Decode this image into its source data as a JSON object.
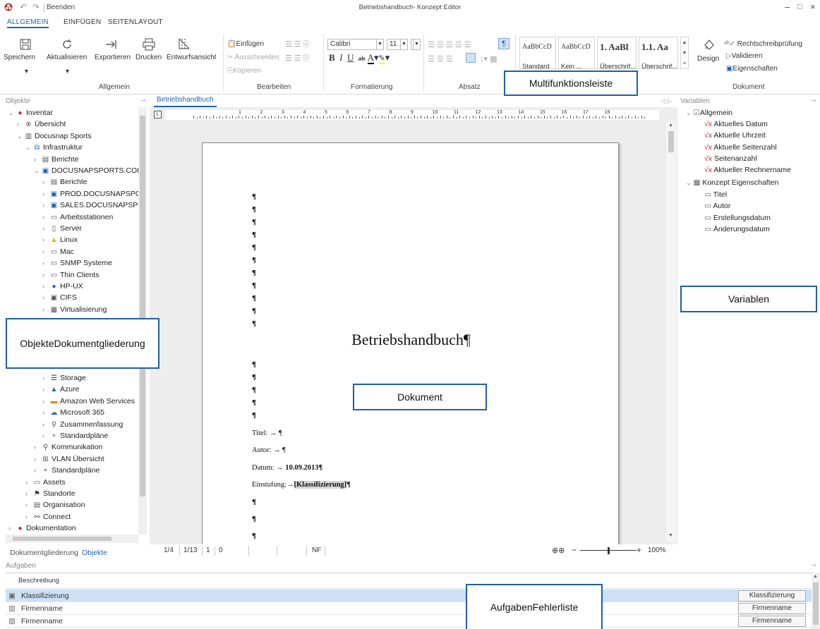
{
  "titlebar": {
    "quit_label": "Beenden",
    "title": "Betriebshandbuch- Konzept Editor",
    "minimize": "–",
    "maximize": "□",
    "close": "×"
  },
  "ribbon_tabs": [
    "ALLGEMEIN",
    "EINFÜGEN",
    "SEITENLAYOUT"
  ],
  "ribbon": {
    "allgemein": {
      "buttons": [
        "Speichern",
        "Aktualisieren",
        "Exportieren",
        "Drucken",
        "Entwurfsansicht"
      ],
      "label": "Allgemein"
    },
    "bearbeiten": {
      "einfuegen": "Einfügen",
      "ausschneiden": "Ausschneiden",
      "kopieren": "Kopieren",
      "label": "Bearbeiten"
    },
    "formatierung": {
      "font": "Calibri",
      "size": "11",
      "label": "Formatierung"
    },
    "absatz": {
      "label": "Absatz"
    },
    "styles": [
      {
        "sample": "AaBbCcD",
        "name": "Standard"
      },
      {
        "sample": "AaBbCcD",
        "name": "Kein ..."
      },
      {
        "sample": "1. AaBl",
        "name": "Überschrif..."
      },
      {
        "sample": "1.1. Aa",
        "name": "Überschrif..."
      }
    ],
    "dokument": {
      "design": "Design",
      "rechtschreibung": "Rechtschreibprüfung",
      "validieren": "Validieren",
      "eigenschaften": "Eigenschaften",
      "label": "Dokument"
    }
  },
  "callouts": {
    "ribbon": "Multifunktionsleiste",
    "objekte_l1": "Objekte",
    "objekte_l2": "Dokumentgliederung",
    "dokument": "Dokument",
    "variablen": "Variablen",
    "aufgaben_l1": "Aufgaben",
    "aufgaben_l2": "Fehlerliste"
  },
  "left_panel": {
    "header": "Objekte",
    "tree": [
      {
        "label": "Inventar",
        "chev": "⌄",
        "icon": "inventory-icon"
      },
      {
        "label": "Übersicht",
        "chev": "›",
        "icon": "globe-icon"
      },
      {
        "label": "Docusnap Sports",
        "chev": "⌄",
        "icon": "company-icon"
      },
      {
        "label": "Infrastruktur",
        "chev": "⌄",
        "icon": "network-icon"
      },
      {
        "label": "Berichte",
        "chev": "›",
        "icon": "report-icon"
      },
      {
        "label": "DOCUSNAPSPORTS.COM",
        "chev": "⌄",
        "icon": "domain-icon"
      },
      {
        "label": "Berichte",
        "chev": "›",
        "icon": "report-icon"
      },
      {
        "label": "PROD.DOCUSNAPSPORTS",
        "chev": "›",
        "icon": "domain-icon"
      },
      {
        "label": "SALES.DOCUSNAPSPORTS",
        "chev": "›",
        "icon": "domain-icon"
      },
      {
        "label": "Arbeitsstationen",
        "chev": "›",
        "icon": "workstation-icon"
      },
      {
        "label": "Server",
        "chev": "›",
        "icon": "server-icon"
      },
      {
        "label": "Linux",
        "chev": "›",
        "icon": "linux-icon"
      },
      {
        "label": "Mac",
        "chev": "›",
        "icon": "mac-icon"
      },
      {
        "label": "SNMP Systeme",
        "chev": "›",
        "icon": "snmp-icon"
      },
      {
        "label": "Thin Clients",
        "chev": "›",
        "icon": "thin-client-icon"
      },
      {
        "label": "HP-UX",
        "chev": "›",
        "icon": "hp-icon"
      },
      {
        "label": "CIFS",
        "chev": "›",
        "icon": "cifs-icon"
      },
      {
        "label": "Virtualisierung",
        "chev": "›",
        "icon": "virtualization-icon"
      }
    ],
    "tree_lower": [
      {
        "label": "Storage",
        "chev": "›",
        "icon": "storage-icon"
      },
      {
        "label": "Azure",
        "chev": "›",
        "icon": "azure-icon"
      },
      {
        "label": "Amazon Web Services",
        "chev": "›",
        "icon": "aws-icon"
      },
      {
        "label": "Microsoft 365",
        "chev": "›",
        "icon": "cloud-icon"
      },
      {
        "label": "Zusammenfassung",
        "chev": "›",
        "icon": "search-icon"
      },
      {
        "label": "Standardpläne",
        "chev": "›",
        "icon": "plan-icon"
      },
      {
        "label": "Kommunikation",
        "chev": "›",
        "icon": "communication-icon"
      },
      {
        "label": "VLAN Übersicht",
        "chev": "›",
        "icon": "vlan-icon"
      },
      {
        "label": "Standardpläne",
        "chev": "›",
        "icon": "plan-icon"
      },
      {
        "label": "Assets",
        "chev": "›",
        "icon": "assets-icon"
      },
      {
        "label": "Standorte",
        "chev": "›",
        "icon": "location-icon"
      },
      {
        "label": "Organisation",
        "chev": "›",
        "icon": "organisation-icon"
      },
      {
        "label": "Connect",
        "chev": "›",
        "icon": "connect-icon"
      },
      {
        "label": "Dokumentation",
        "chev": "›",
        "icon": "inventory-icon"
      }
    ],
    "tabs": [
      "Dokumentgliederung",
      "Objekte"
    ]
  },
  "document": {
    "tab": "Betriebshandbuch",
    "title": "Betriebshandbuch¶",
    "pilcrow": "¶",
    "fields": {
      "titel": "Titel:  →  ¶",
      "autor": "Autor:  →  ¶",
      "datum_label": "Datum:  →  ",
      "datum_value": "10.09.2013¶",
      "einstufung_label": "Einstufung:→",
      "einstufung_value": "[Klassifizierung]",
      "einstufung_end": "¶"
    },
    "ruler_numbers": [
      "1",
      "2",
      "3",
      "4",
      "5",
      "6",
      "7",
      "8",
      "9",
      "10",
      "11",
      "12",
      "13",
      "14",
      "15",
      "16",
      "17",
      "18"
    ]
  },
  "statusbar": {
    "page": "1/4",
    "section": "1/13",
    "line": "1",
    "col": "0",
    "mode": "NF",
    "zoom": "100%",
    "zoom_level": 0.5
  },
  "right_panel": {
    "header": "Variablen",
    "allgemein": "Allgemein",
    "allgemein_items": [
      "Aktuelles Datum",
      "Aktuelle Uhrzeit",
      "Aktuelle Seitenzahl",
      "Seitenanzahl",
      "Aktueller Rechnername"
    ],
    "konzept": "Konzept Eigenschaften",
    "konzept_items": [
      "Titel",
      "Autor",
      "Erstellungsdatum",
      "Änderungsdatum"
    ]
  },
  "bottom_panel": {
    "header": "Aufgaben",
    "column": "Beschreibung",
    "rows": [
      {
        "desc": "Klassifizierung",
        "action": "Klassifizierung"
      },
      {
        "desc": "Firmenname",
        "action": "Firmenname"
      },
      {
        "desc": "Firmenname",
        "action": "Firmenname"
      }
    ]
  }
}
